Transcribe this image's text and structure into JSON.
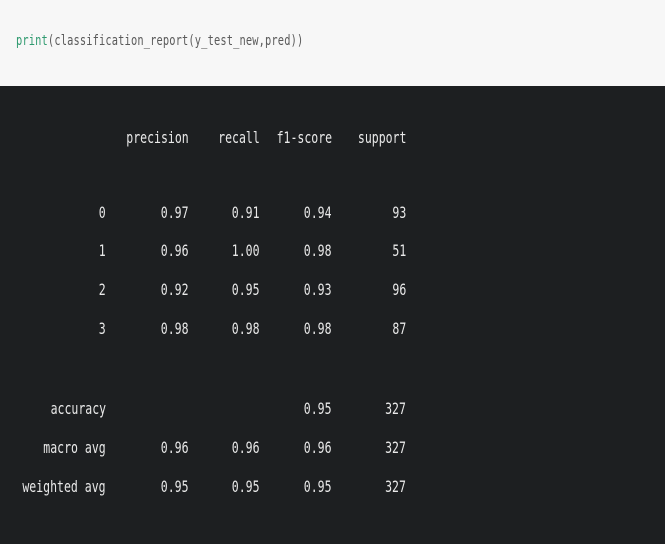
{
  "code": {
    "fn": "print",
    "args": "(classification_report(y_test_new,pred))"
  },
  "report": {
    "columns": [
      "precision",
      "recall",
      "f1-score",
      "support"
    ],
    "rows": [
      {
        "label": "0",
        "precision": "0.97",
        "recall": "0.91",
        "f1": "0.94",
        "support": "93"
      },
      {
        "label": "1",
        "precision": "0.96",
        "recall": "1.00",
        "f1": "0.98",
        "support": "51"
      },
      {
        "label": "2",
        "precision": "0.92",
        "recall": "0.95",
        "f1": "0.93",
        "support": "96"
      },
      {
        "label": "3",
        "precision": "0.98",
        "recall": "0.98",
        "f1": "0.98",
        "support": "87"
      }
    ],
    "summary": [
      {
        "label": "accuracy",
        "precision": "",
        "recall": "",
        "f1": "0.95",
        "support": "327"
      },
      {
        "label": "macro avg",
        "precision": "0.96",
        "recall": "0.96",
        "f1": "0.96",
        "support": "327"
      },
      {
        "label": "weighted avg",
        "precision": "0.95",
        "recall": "0.95",
        "f1": "0.95",
        "support": "327"
      }
    ]
  },
  "colors": {
    "code_keyword": "#2f9a6f",
    "output_background": "#1d1f21",
    "output_text": "#e9e9e9"
  }
}
